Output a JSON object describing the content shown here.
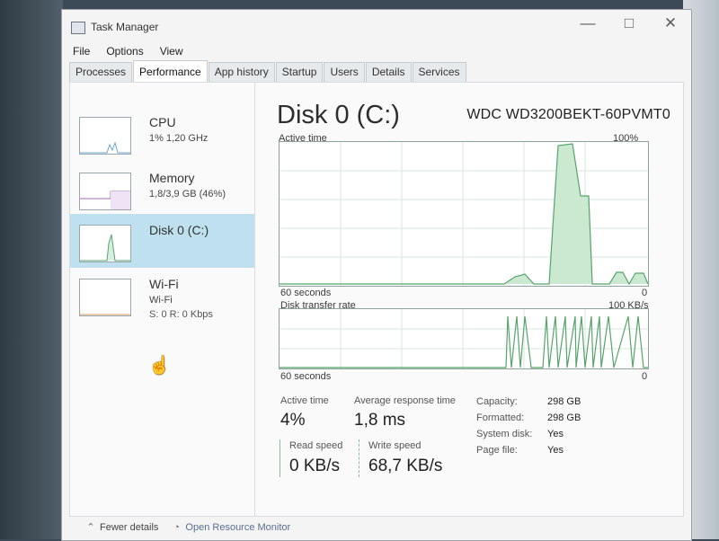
{
  "window": {
    "title": "Task Manager",
    "controls": {
      "minimize": "—",
      "maximize": "□",
      "close": "✕"
    }
  },
  "menu": [
    "File",
    "Options",
    "View"
  ],
  "tabs": [
    "Processes",
    "Performance",
    "App history",
    "Startup",
    "Users",
    "Details",
    "Services"
  ],
  "sidebar": {
    "items": [
      {
        "title": "CPU",
        "sub": "1% 1,20 GHz",
        "sub2": ""
      },
      {
        "title": "Memory",
        "sub": "1,8/3,9 GB (46%)",
        "sub2": ""
      },
      {
        "title": "Disk 0 (C:)",
        "sub": "",
        "sub2": ""
      },
      {
        "title": "Wi-Fi",
        "sub": "Wi-Fi",
        "sub2": "S: 0 R: 0 Kbps"
      }
    ]
  },
  "main": {
    "title": "Disk 0 (C:)",
    "model": "WDC WD3200BEKT-60PVMT0",
    "graph1": {
      "label": "Active time",
      "max": "100%",
      "x_left": "60 seconds",
      "x_right": "0"
    },
    "graph2": {
      "label": "Disk transfer rate",
      "max": "100 KB/s",
      "x_left": "60 seconds",
      "x_right": "0"
    },
    "stats": {
      "active_time_label": "Active time",
      "active_time_value": "4%",
      "avg_response_label": "Average response time",
      "avg_response_value": "1,8 ms",
      "read_speed_label": "Read speed",
      "read_speed_value": "0 KB/s",
      "write_speed_label": "Write speed",
      "write_speed_value": "68,7 KB/s"
    },
    "details": [
      {
        "label": "Capacity:",
        "value": "298 GB"
      },
      {
        "label": "Formatted:",
        "value": "298 GB"
      },
      {
        "label": "System disk:",
        "value": "Yes"
      },
      {
        "label": "Page file:",
        "value": "Yes"
      }
    ]
  },
  "footer": {
    "fewer_details": "Fewer details",
    "open_monitor": "Open Resource Monitor"
  },
  "colors": {
    "graph_green": "#56a46b",
    "graph_fill": "#cbe8d1",
    "selected_bg": "#bfe0ef"
  }
}
